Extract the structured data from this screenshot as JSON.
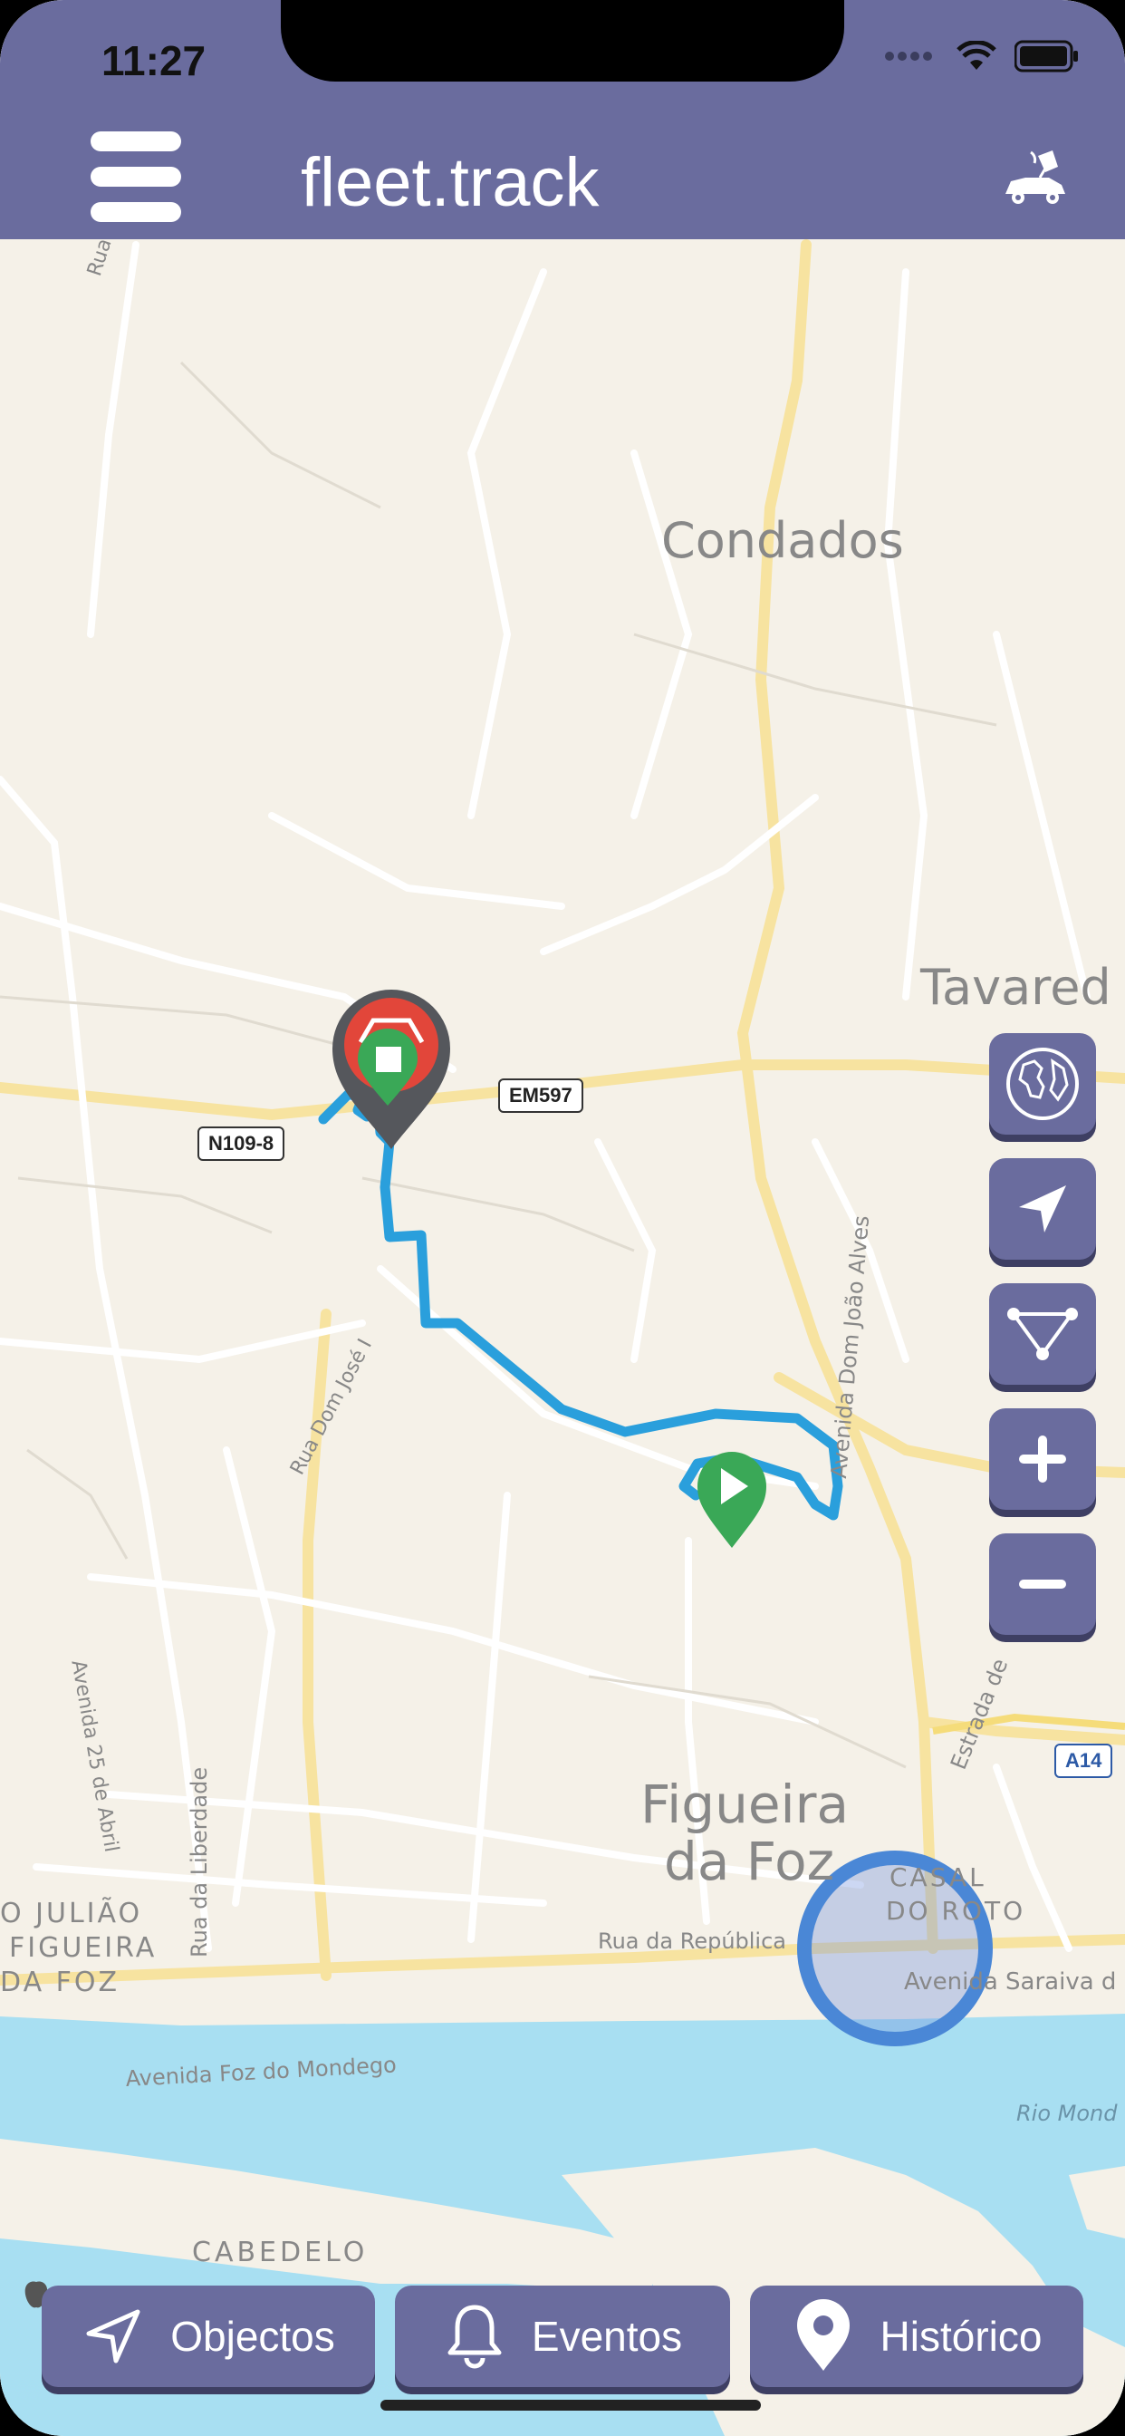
{
  "status_bar": {
    "time": "11:27"
  },
  "header": {
    "title": "fleet.track",
    "menu_icon": "hamburger-menu-icon",
    "car_icon": "car-satellite-icon"
  },
  "map": {
    "places": [
      {
        "name": "Condados"
      },
      {
        "name": "Tavared"
      },
      {
        "name": "Figueira"
      },
      {
        "name": "da Foz"
      },
      {
        "name": "CASAL"
      },
      {
        "name": "DO ROTO"
      },
      {
        "name": "CABEDELO"
      },
      {
        "name": "O JULIÃO"
      },
      {
        "name": "FIGUEIRA"
      },
      {
        "name": "DA FOZ"
      }
    ],
    "streets": [
      {
        "name": "Rua Co"
      },
      {
        "name": "Rua Dom José I"
      },
      {
        "name": "Avenida Dom João Alves"
      },
      {
        "name": "Estrada de"
      },
      {
        "name": "Avenida 25 de Abril"
      },
      {
        "name": "Rua da Liberdade"
      },
      {
        "name": "Rua da República"
      },
      {
        "name": "Avenida Saraiva d"
      },
      {
        "name": "Avenida Foz do Mondego"
      },
      {
        "name": "Rio Mond"
      }
    ],
    "shields": [
      {
        "label": "N109-8"
      },
      {
        "label": "EM597"
      },
      {
        "label": "A14"
      }
    ],
    "route_color": "#2a9fdc",
    "start_marker_color": "#3aa857",
    "end_marker_color": "#e2463a"
  },
  "map_controls": [
    {
      "name": "globe-icon",
      "label": "Map type"
    },
    {
      "name": "location-arrow-icon",
      "label": "My location"
    },
    {
      "name": "route-icon",
      "label": "Route"
    },
    {
      "name": "zoom-in-icon",
      "label": "+"
    },
    {
      "name": "zoom-out-icon",
      "label": "−"
    }
  ],
  "bottom_nav": {
    "objects": {
      "label": "Objectos",
      "icon": "navigation-arrow-icon"
    },
    "events": {
      "label": "Eventos",
      "icon": "bell-icon"
    },
    "history": {
      "label": "Histórico",
      "icon": "map-pin-icon"
    }
  },
  "colors": {
    "accent": "#6a6c9e",
    "accent_dark": "#3e3f63",
    "water": "#a8dff2",
    "land": "#f5f1e8"
  }
}
